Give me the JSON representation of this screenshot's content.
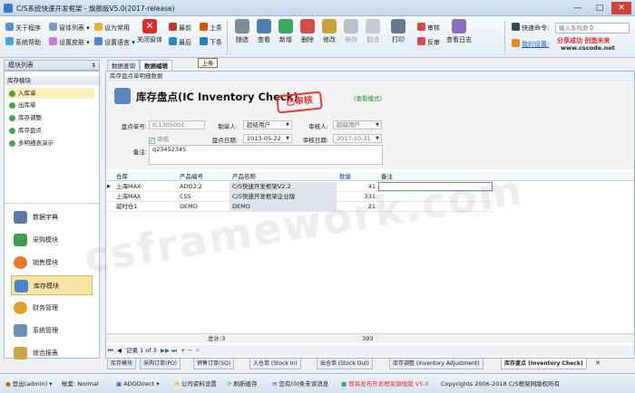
{
  "window": {
    "title": "C/S系统快速开发框架 - 旗舰版V5.0(2017-release)"
  },
  "toolbar": {
    "col1": [
      "关于程序",
      "系统帮助"
    ],
    "col2": [
      "窗体列表",
      "设置皮肤"
    ],
    "col3": [
      "设为常用",
      "设置语言"
    ],
    "close_label": "关闭窗体",
    "nav": [
      "最前",
      "上条",
      "最后",
      "下条"
    ],
    "big": [
      "随选",
      "查看",
      "新增",
      "删除",
      "修改",
      "保存",
      "取消",
      "打印"
    ],
    "approve": [
      "审核",
      "反审"
    ],
    "log_label": "查看日志",
    "quick_cmd_label": "快速命令:",
    "quick_cmd_placeholder": "输入系统命令",
    "my_settings": "我的设置:",
    "slogan": "分享成功 创造未来",
    "site": "www.cscode.net"
  },
  "sidebar": {
    "header": "模块列表",
    "group": "库存模块",
    "items": [
      "入库单",
      "出库单",
      "库存调整",
      "库存盘点",
      "多明细表演示"
    ],
    "modules": [
      "数据字典",
      "采购模块",
      "销售模块",
      "库存模块",
      "财务管理",
      "系统管理",
      "综合报表"
    ]
  },
  "tabs": [
    "数据查询",
    "数据编辑"
  ],
  "tooltip": "上条",
  "crumb": "库存盘点单明细数据",
  "form": {
    "title": "库存盘点(IC Inventory Check)",
    "stamp": "已审核",
    "view_mode": "(查看模式)",
    "doc_no_label": "盘点单号:",
    "doc_no": "IC1305001",
    "creator_label": "制单人:",
    "creator": "超级用户",
    "approver_label": "审核人:",
    "approver": "超级用户",
    "approved_check": "审核",
    "date_label": "盘点日期:",
    "date": "2013-05-22",
    "approve_date_label": "审核日期:",
    "approve_date": "2017-10-31",
    "remark_label": "备注:",
    "remark": "q23452345"
  },
  "grid": {
    "headers": [
      "仓库",
      "产品编号",
      "产品名称",
      "数量",
      "备注"
    ],
    "rows": [
      [
        "上海MAX",
        "ADO2.2",
        "C/S快速开发框架V2.2",
        "41",
        ""
      ],
      [
        "上海MAX",
        "CS5",
        "C/S快速开发框架企业版",
        "331",
        ""
      ],
      [
        "韶时仓1",
        "DEMO",
        "DEMO",
        "21",
        ""
      ]
    ],
    "total_label": "总计:3",
    "total_qty": "393",
    "pager": "记录 1 of 3"
  },
  "doc_tabs": [
    "库存模块",
    "采购订单(PO)",
    "销售订单(SO)",
    "入仓单 (Stock In)",
    "出仓单 (Stock Out)",
    "库存调整 (Inventory Adjustment)",
    "库存盘点 (Inventory Check)"
  ],
  "status": {
    "login": "登出(admin)",
    "account": "帐套: Normal",
    "db": "ADODirect",
    "company": "公司资料设置",
    "refresh": "刷新缓存",
    "messages": "您有(0)条未读消息",
    "release": "即将发布开发框架旗舰版 V5.0",
    "copyright": "Copyrights 2006-2018 C/S框架网版权所有"
  },
  "watermark": "csframework.com",
  "colors": {
    "accent": "#3b78c3",
    "stamp": "#e33a3a",
    "selected": "#fbf1b8",
    "red": "#e02b2b"
  }
}
